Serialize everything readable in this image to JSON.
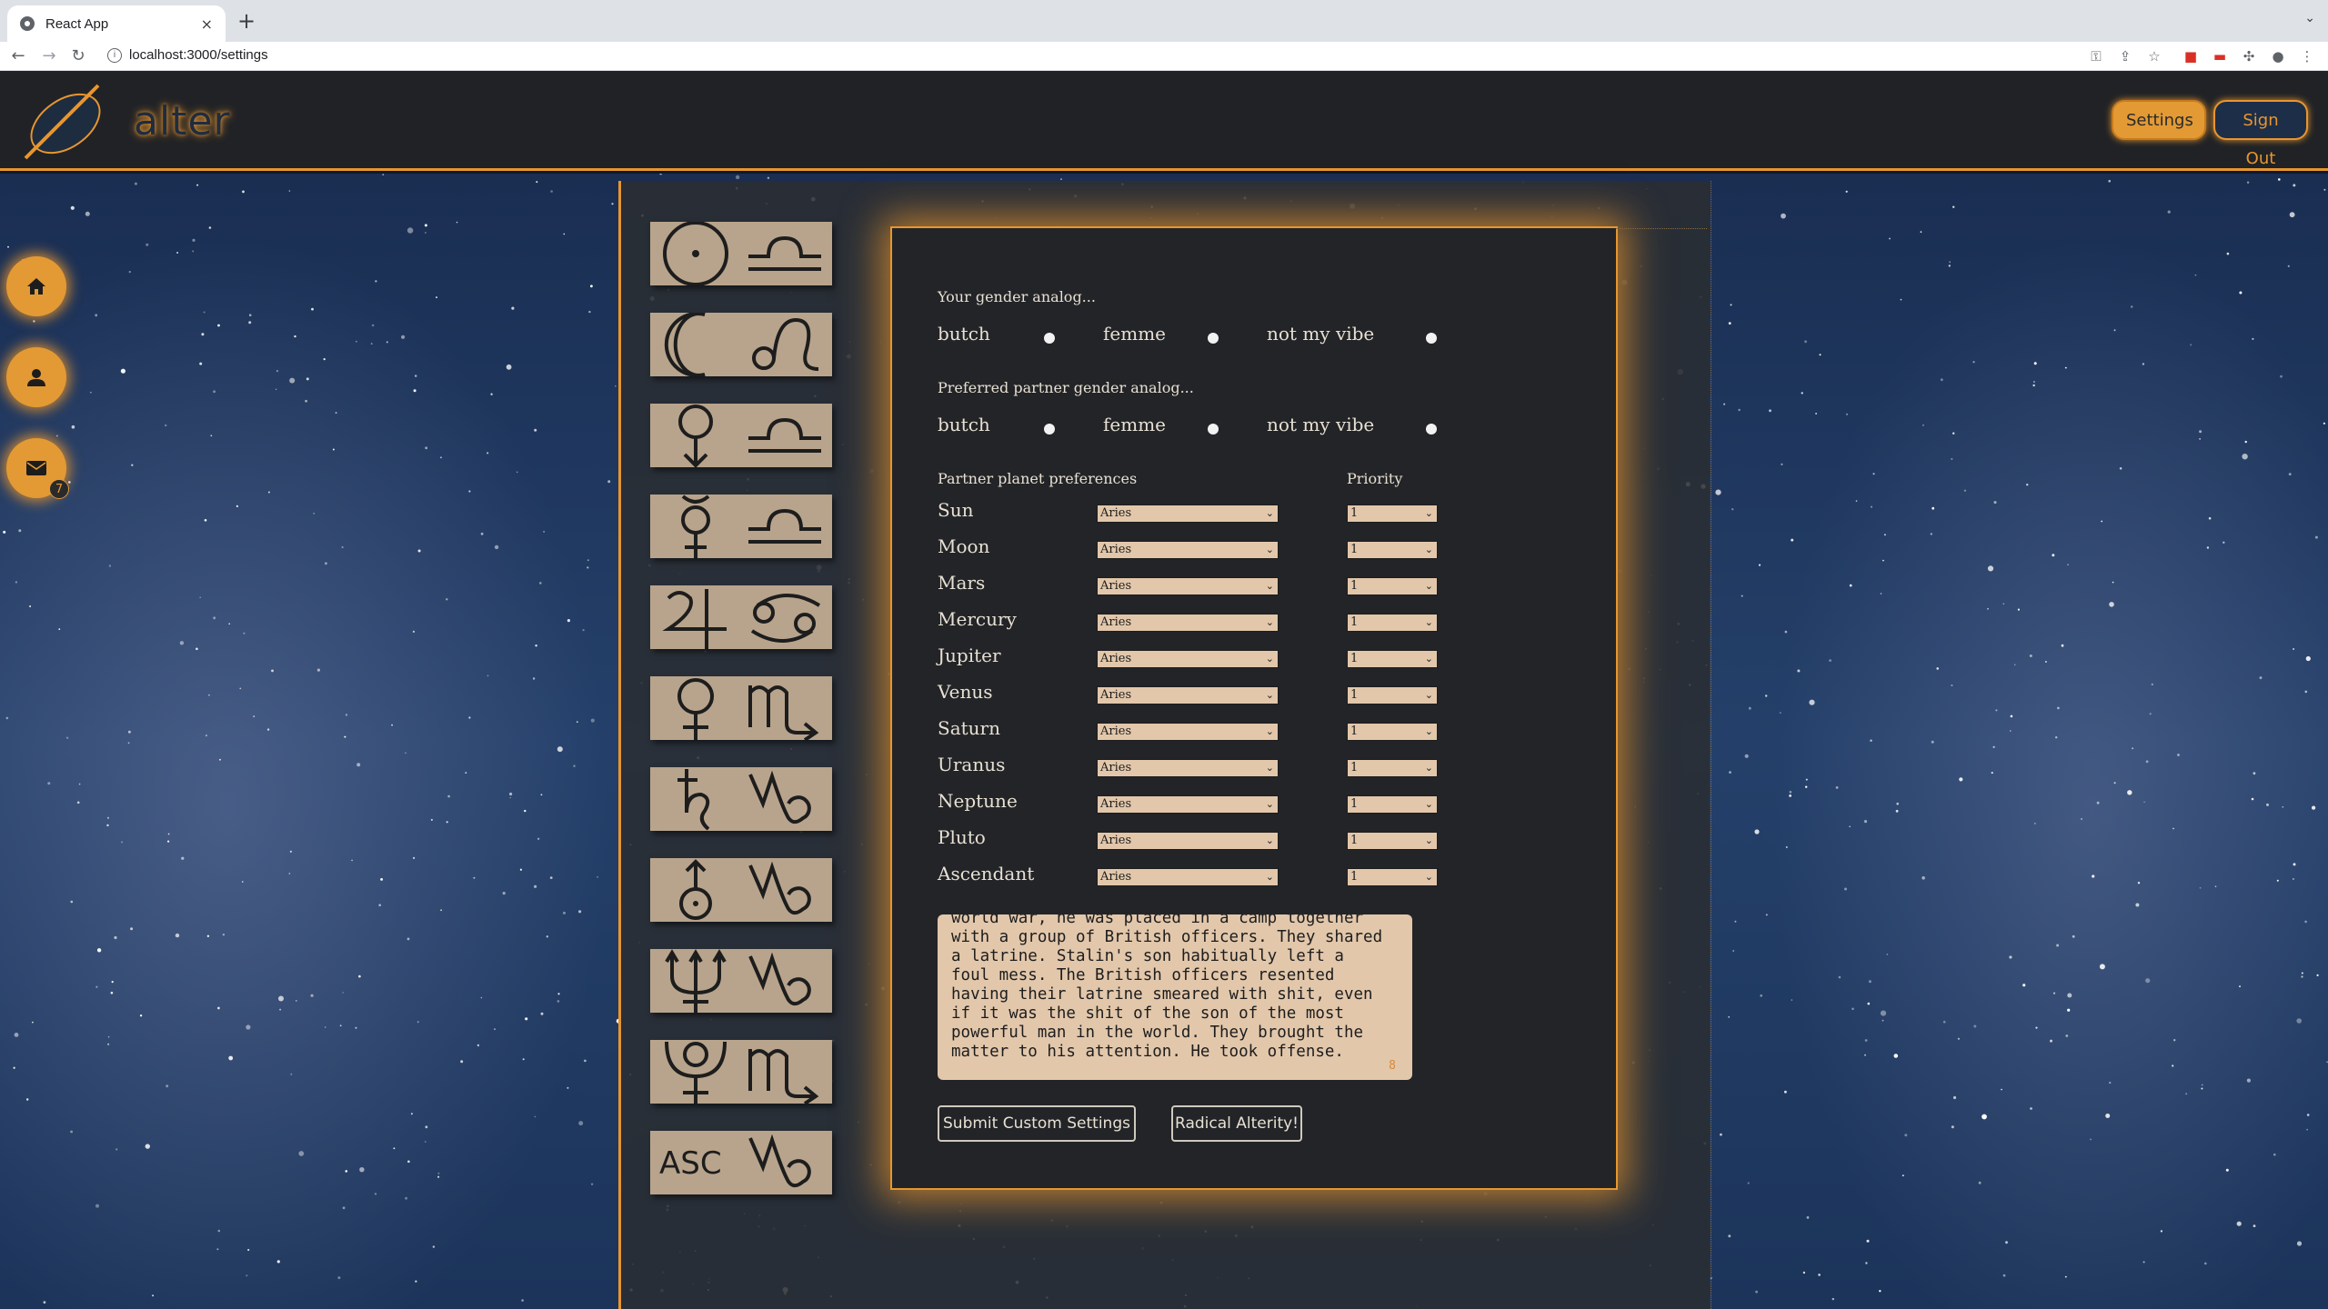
{
  "browser": {
    "tab_title": "React App",
    "tab_close": "×",
    "new_tab": "+",
    "url": "localhost:3000/settings",
    "back": "←",
    "forward": "→",
    "reload": "↻",
    "info": "i"
  },
  "header": {
    "logo_text": "alter",
    "settings_label": "Settings",
    "signout_label": "Sign Out"
  },
  "sidebar": {
    "mail_badge": "7"
  },
  "chart": {
    "ascendant_label": "ASC"
  },
  "form": {
    "gender_prompt": "Your gender analog...",
    "partner_gender_prompt": "Preferred partner gender analog...",
    "gender_options": [
      "butch",
      "femme",
      "not my vibe"
    ],
    "planet_header": "Partner planet preferences",
    "priority_header": "Priority",
    "planets": [
      {
        "name": "Sun",
        "sign": "Aries",
        "priority": "1"
      },
      {
        "name": "Moon",
        "sign": "Aries",
        "priority": "1"
      },
      {
        "name": "Mars",
        "sign": "Aries",
        "priority": "1"
      },
      {
        "name": "Mercury",
        "sign": "Aries",
        "priority": "1"
      },
      {
        "name": "Jupiter",
        "sign": "Aries",
        "priority": "1"
      },
      {
        "name": "Venus",
        "sign": "Aries",
        "priority": "1"
      },
      {
        "name": "Saturn",
        "sign": "Aries",
        "priority": "1"
      },
      {
        "name": "Uranus",
        "sign": "Aries",
        "priority": "1"
      },
      {
        "name": "Neptune",
        "sign": "Aries",
        "priority": "1"
      },
      {
        "name": "Pluto",
        "sign": "Aries",
        "priority": "1"
      },
      {
        "name": "Ascendant",
        "sign": "Aries",
        "priority": "1"
      }
    ],
    "bio_text": "world war, he was placed in a camp together\nwith a group of British officers. They shared\na latrine. Stalin's son habitually left a\nfoul mess. The British officers resented\nhaving their latrine smeared with shit, even\nif it was the shit of the son of the most\npowerful man in the world. They brought the\nmatter to his attention. He took offense.",
    "bio_counter": "8",
    "submit_label": "Submit Custom Settings",
    "radical_label": "Radical Alterity!"
  },
  "colors": {
    "accent": "#e8962e",
    "panel": "#232427",
    "field": "#e2c7ab",
    "card": "#b8a48c"
  }
}
